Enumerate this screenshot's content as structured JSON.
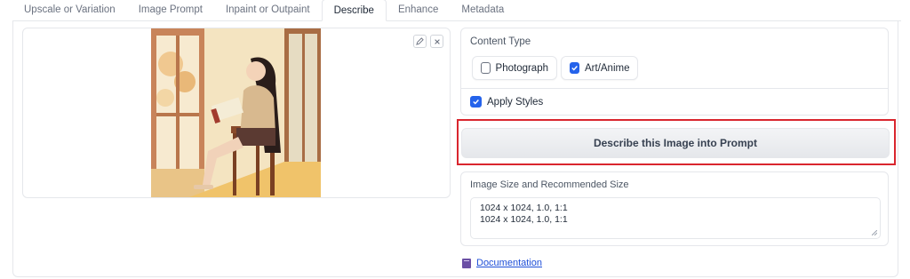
{
  "tabs": [
    {
      "label": "Upscale or Variation"
    },
    {
      "label": "Image Prompt"
    },
    {
      "label": "Inpaint or Outpaint"
    },
    {
      "label": "Describe"
    },
    {
      "label": "Enhance"
    },
    {
      "label": "Metadata"
    }
  ],
  "active_tab": "Describe",
  "image_panel": {
    "tools": [
      "pencil-icon",
      "close-icon"
    ]
  },
  "content_type": {
    "label": "Content Type",
    "options": [
      {
        "label": "Photograph",
        "checked": false
      },
      {
        "label": "Art/Anime",
        "checked": true
      }
    ]
  },
  "apply_styles": {
    "label": "Apply Styles",
    "checked": true
  },
  "describe_button": {
    "label": "Describe this Image into Prompt"
  },
  "image_size": {
    "label": "Image Size and Recommended Size",
    "lines": [
      "1024 x 1024, 1.0, 1:1",
      "1024 x 1024, 1.0, 1:1"
    ]
  },
  "documentation": {
    "label": "Documentation",
    "icon": "book-icon"
  },
  "colors": {
    "accent": "#2563eb",
    "highlight": "#d9262e",
    "link": "#1d4ed8"
  }
}
